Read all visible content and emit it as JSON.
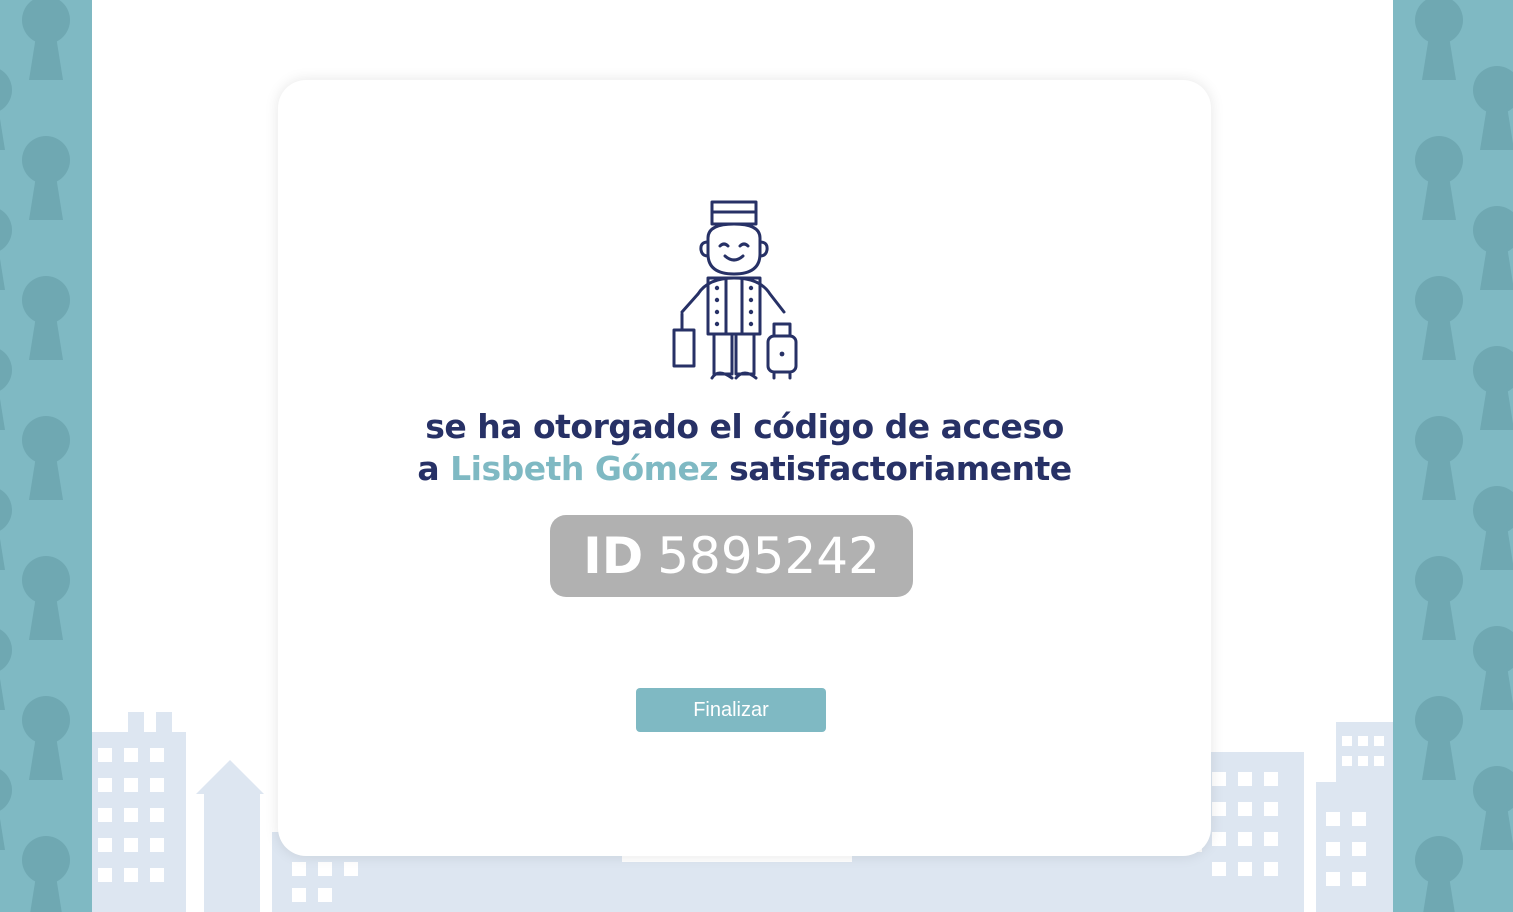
{
  "colors": {
    "primary": "#273166",
    "accent": "#7fb9c3",
    "badge_bg": "#b1b1b1",
    "side_bg": "#7fb9c3",
    "keyhole": "#6fa8b2",
    "city": "#dde6f1"
  },
  "icons": {
    "illustration": "bellhop-icon",
    "side_pattern": "keyhole-icon"
  },
  "message": {
    "line1": "se ha otorgado el código de acceso",
    "line2_prefix": "a",
    "recipient_name": "Lisbeth Gómez",
    "line2_suffix": "satisfactoriamente"
  },
  "access_code": {
    "label": "ID",
    "value": "5895242"
  },
  "actions": {
    "finish_label": "Finalizar"
  }
}
